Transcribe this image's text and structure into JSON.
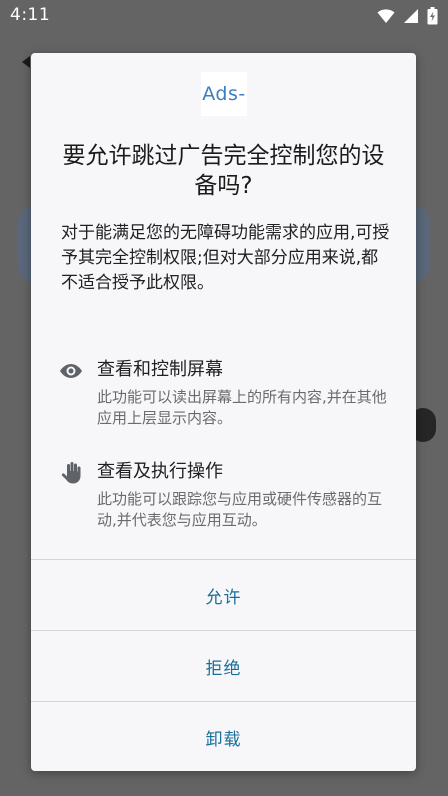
{
  "status_bar": {
    "time": "4:11"
  },
  "dialog": {
    "app_icon_text": "Ads-",
    "title": "要允许跳过广告完全控制您的设备吗?",
    "description": "对于能满足您的无障碍功能需求的应用,可授予其完全控制权限;但对大部分应用来说,都不适合授予此权限。",
    "permissions": [
      {
        "icon": "eye-icon",
        "title": "查看和控制屏幕",
        "description": "此功能可以读出屏幕上的所有内容,并在其他应用上层显示内容。"
      },
      {
        "icon": "hand-icon",
        "title": "查看及执行操作",
        "description": "此功能可以跟踪您与应用或硬件传感器的互动,并代表您与应用互动。"
      }
    ],
    "actions": {
      "allow": "允许",
      "deny": "拒绝",
      "uninstall": "卸载"
    }
  },
  "colors": {
    "action_text": "#1a6e9a",
    "dialog_bg": "#f7f7f9",
    "scrim": "#6e6e6e"
  }
}
